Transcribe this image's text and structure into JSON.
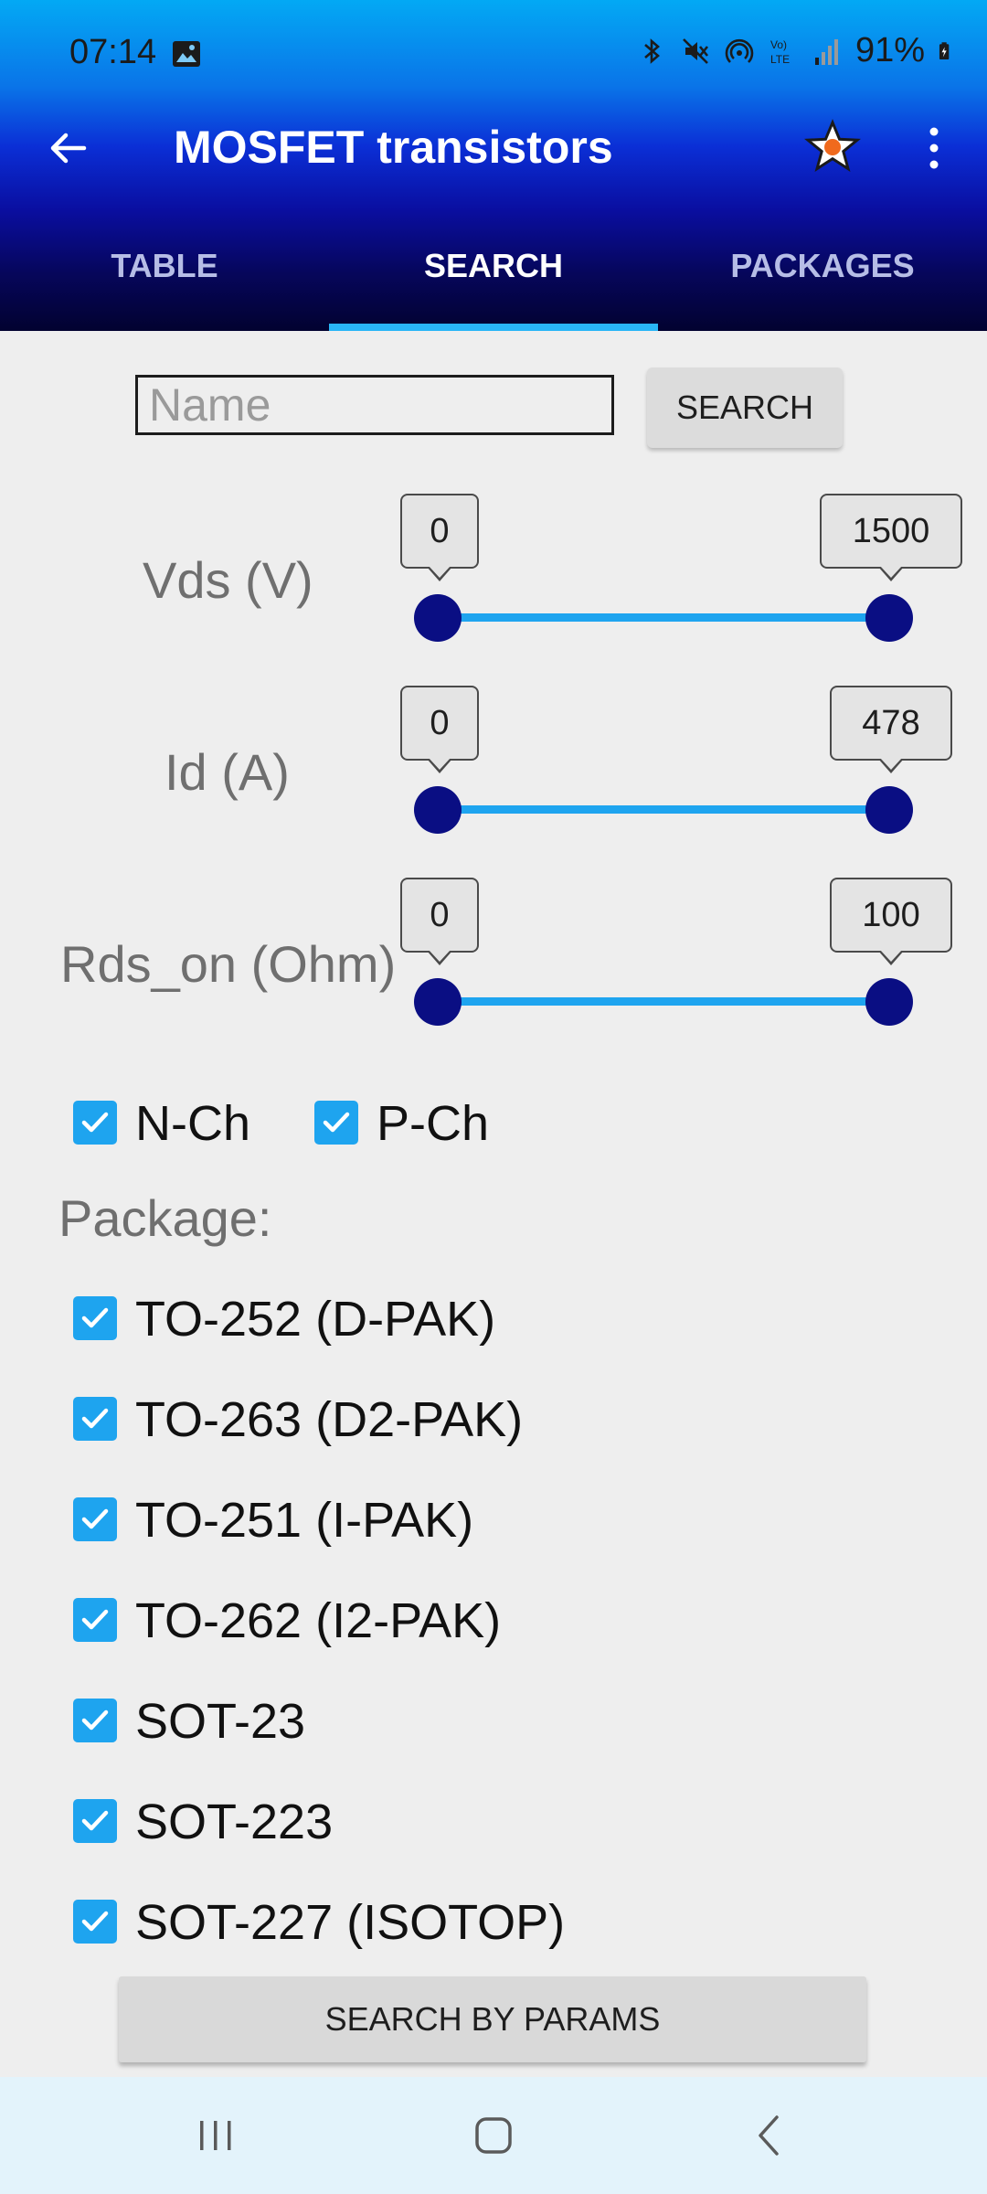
{
  "status_bar": {
    "time": "07:14",
    "battery": "91%",
    "icons": [
      "image-icon",
      "bluetooth-icon",
      "mute-icon",
      "hotspot-icon",
      "volte-icon",
      "signal-icon",
      "battery-charging-icon"
    ]
  },
  "app_bar": {
    "title": "MOSFET transistors",
    "icons": [
      "back-arrow-icon",
      "star-icon",
      "more-vert-icon"
    ]
  },
  "tabs": [
    {
      "label": "TABLE",
      "selected": false
    },
    {
      "label": "SEARCH",
      "selected": true
    },
    {
      "label": "PACKAGES",
      "selected": false
    }
  ],
  "search": {
    "placeholder": "Name",
    "value": "",
    "button_label": "SEARCH"
  },
  "sliders": [
    {
      "label": "Vds (V)",
      "min_value": "0",
      "max_value": "1500"
    },
    {
      "label": "Id (A)",
      "min_value": "0",
      "max_value": "478"
    },
    {
      "label": "Rds_on (Ohm)",
      "min_value": "0",
      "max_value": "100"
    }
  ],
  "channel": [
    {
      "label": "N-Ch",
      "checked": true
    },
    {
      "label": "P-Ch",
      "checked": true
    }
  ],
  "package_label": "Package:",
  "packages": [
    {
      "label": "TO-252 (D-PAK)",
      "checked": true
    },
    {
      "label": "TO-263 (D2-PAK)",
      "checked": true
    },
    {
      "label": "TO-251 (I-PAK)",
      "checked": true
    },
    {
      "label": "TO-262 (I2-PAK)",
      "checked": true
    },
    {
      "label": "SOT-23",
      "checked": true
    },
    {
      "label": "SOT-223",
      "checked": true
    },
    {
      "label": "SOT-227 (ISOTOP)",
      "checked": true
    }
  ],
  "params_button_label": "SEARCH BY PARAMS",
  "colors": {
    "accent": "#1ea4ef",
    "thumb": "#0a0e83",
    "header_top": "#03a9f4",
    "header_bottom": "#020230"
  }
}
